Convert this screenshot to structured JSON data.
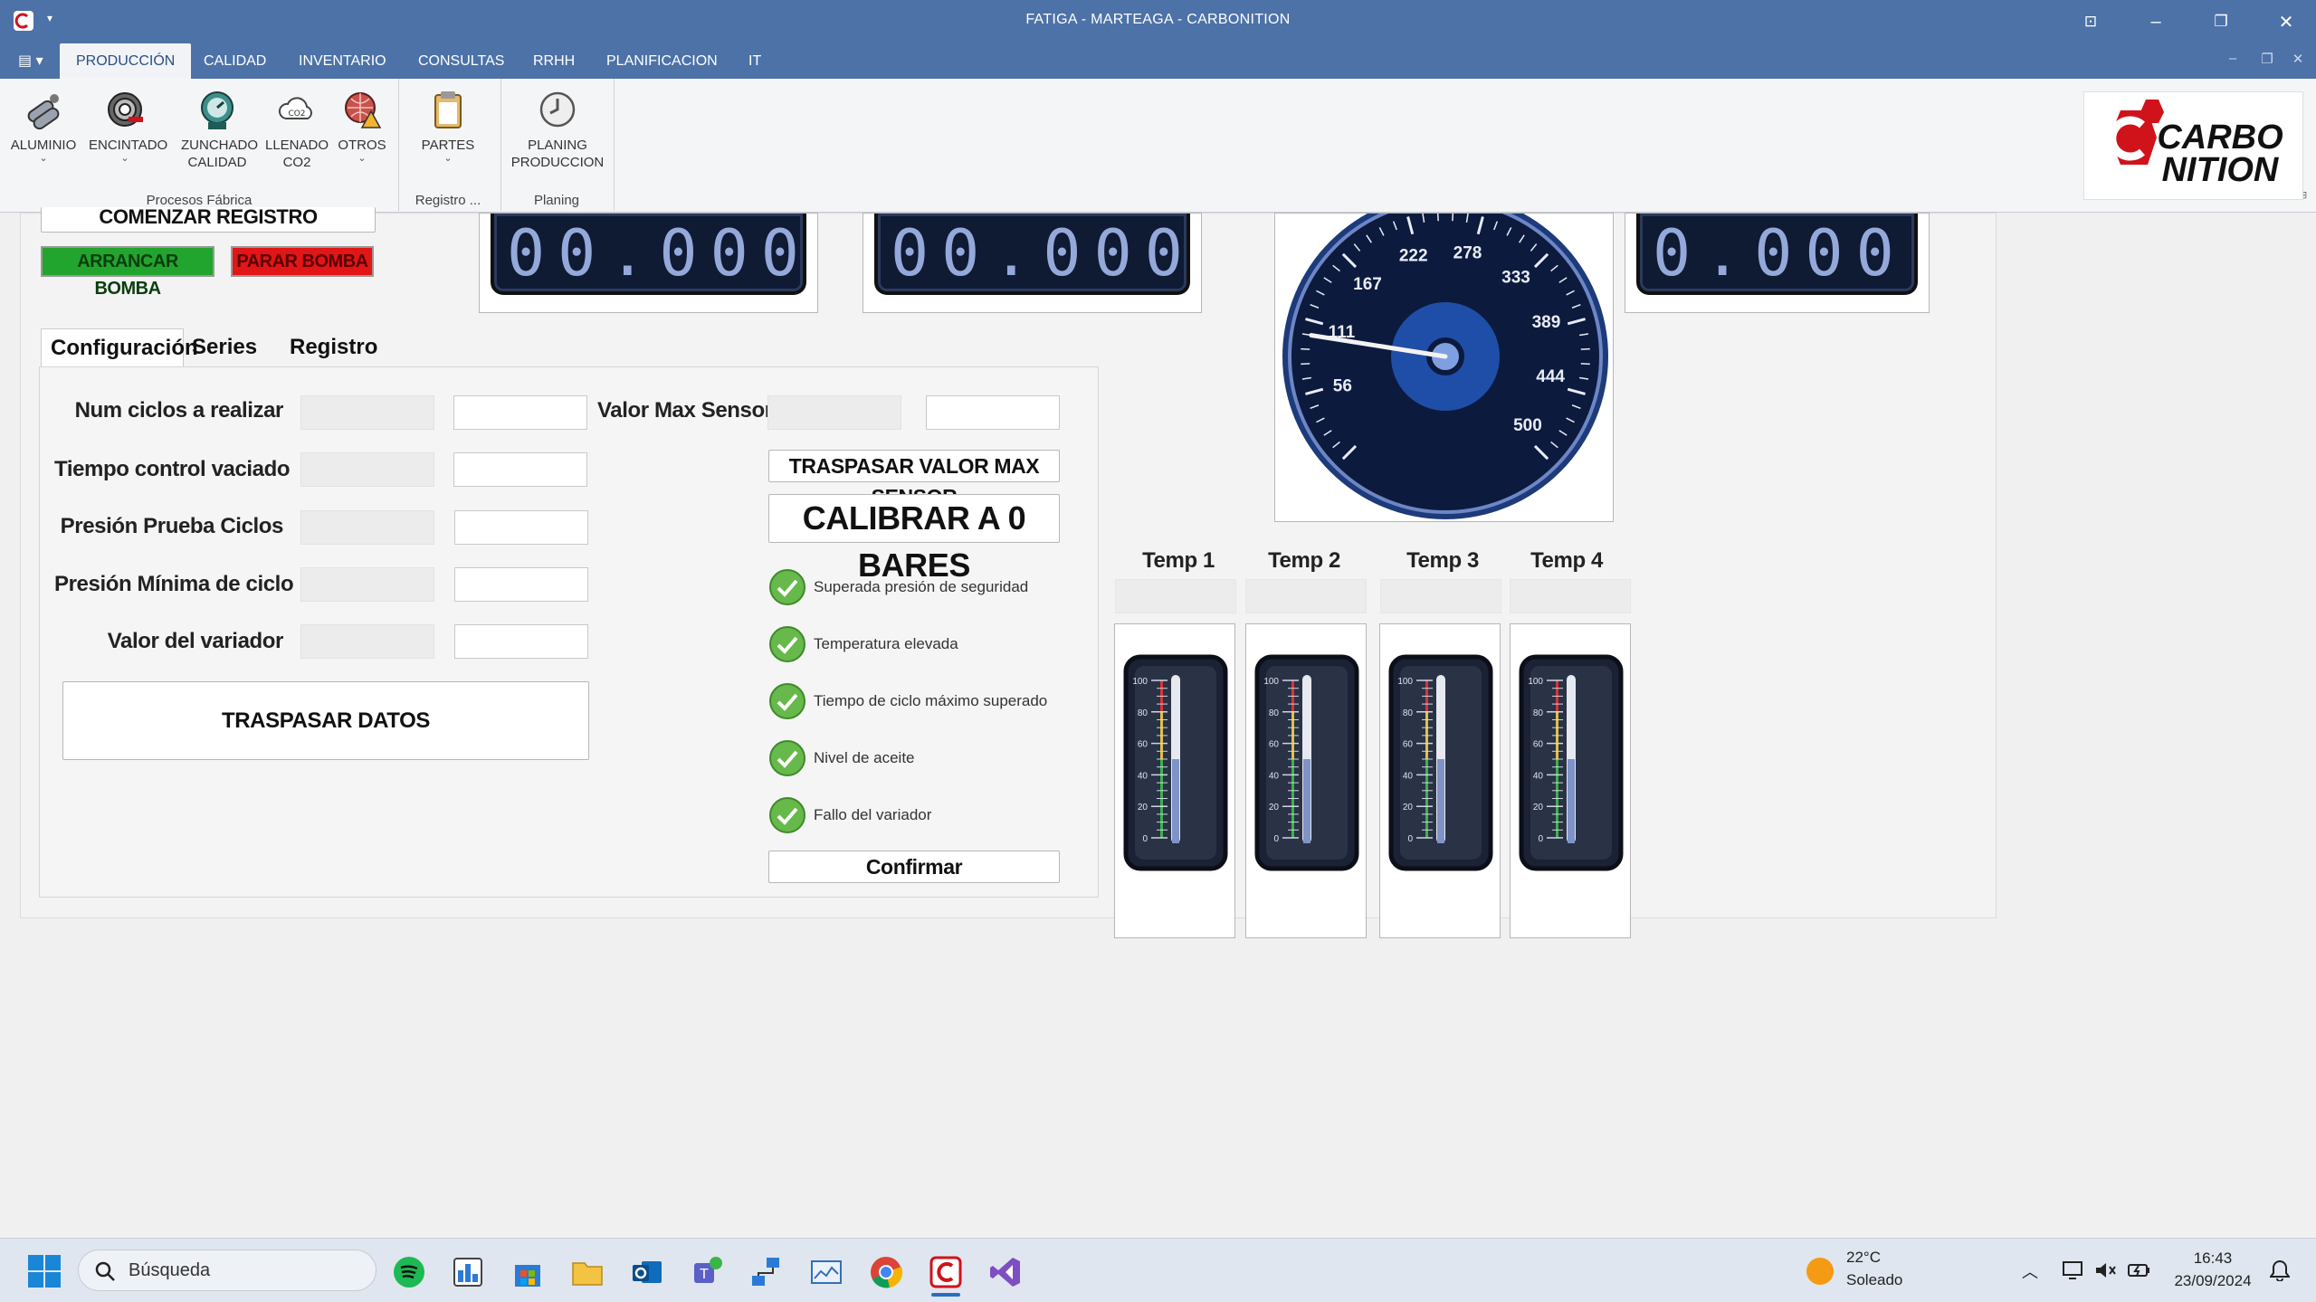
{
  "window": {
    "title": "FATIGA - MARTEAGA - CARBONITION"
  },
  "ribbon": {
    "tabs": [
      "PRODUCCIÓN",
      "CALIDAD",
      "INVENTARIO",
      "CONSULTAS",
      "RRHH",
      "PLANIFICACION",
      "IT"
    ],
    "active_tab": "PRODUCCIÓN",
    "buttons": {
      "aluminio": "ALUMINIO",
      "encintado": "ENCINTADO",
      "zunchado_1": "ZUNCHADO",
      "zunchado_2": "CALIDAD",
      "llenado_1": "LLENADO",
      "llenado_2": "CO2",
      "otros": "OTROS",
      "partes": "PARTES",
      "planing_1": "PLANING",
      "planing_2": "PRODUCCION"
    },
    "groups": {
      "procesos": "Procesos Fábrica",
      "registro": "Registro ...",
      "planing": "Planing"
    },
    "logo_text_1": "CARBO",
    "logo_text_2": "NITION"
  },
  "controls": {
    "comenzar": "COMENZAR REGISTRO",
    "arrancar": "ARRANCAR BOMBA",
    "parar": "PARAR BOMBA"
  },
  "displays": {
    "lcd1": "00.000",
    "lcd2": "00.000",
    "lcd3": "0.000"
  },
  "gauge": {
    "ticks": [
      "56",
      "111",
      "167",
      "222",
      "278",
      "333",
      "389",
      "444",
      "500"
    ],
    "value_fraction": 0.2
  },
  "tabs": {
    "configuracion": "Configuración",
    "series": "Series",
    "registro": "Registro"
  },
  "form": {
    "num_ciclos": "Num ciclos a realizar",
    "tiempo_control": "Tiempo control vaciado",
    "presion_prueba": "Presión Prueba Ciclos",
    "presion_minima": "Presión Mínima de ciclo",
    "valor_variador": "Valor del variador",
    "valor_max_sensor": "Valor Max Sensor",
    "traspasar_datos": "TRASPASAR DATOS",
    "traspasar_valor_max": "TRASPASAR VALOR MAX SENSOR",
    "calibrar": "CALIBRAR A 0 BARES",
    "confirmar": "Confirmar"
  },
  "alarms": [
    "Superada presión de seguridad",
    "Temperatura elevada",
    "Tiempo de ciclo máximo superado",
    "Nivel de aceite",
    "Fallo del variador"
  ],
  "temps": {
    "labels": [
      "Temp 1",
      "Temp 2",
      "Temp 3",
      "Temp 4"
    ],
    "scale": [
      "100",
      "80",
      "60",
      "40",
      "20",
      "0"
    ],
    "levels": [
      0.5,
      0.5,
      0.5,
      0.5
    ]
  },
  "taskbar": {
    "search_placeholder": "Búsqueda",
    "weather_temp": "22°C",
    "weather_desc": "Soleado",
    "time": "16:43",
    "date": "23/09/2024"
  },
  "colors": {
    "titlebar": "#4d72a8",
    "green_button": "#22a52e",
    "red_button": "#e21616",
    "accent_red": "#d0121b"
  }
}
